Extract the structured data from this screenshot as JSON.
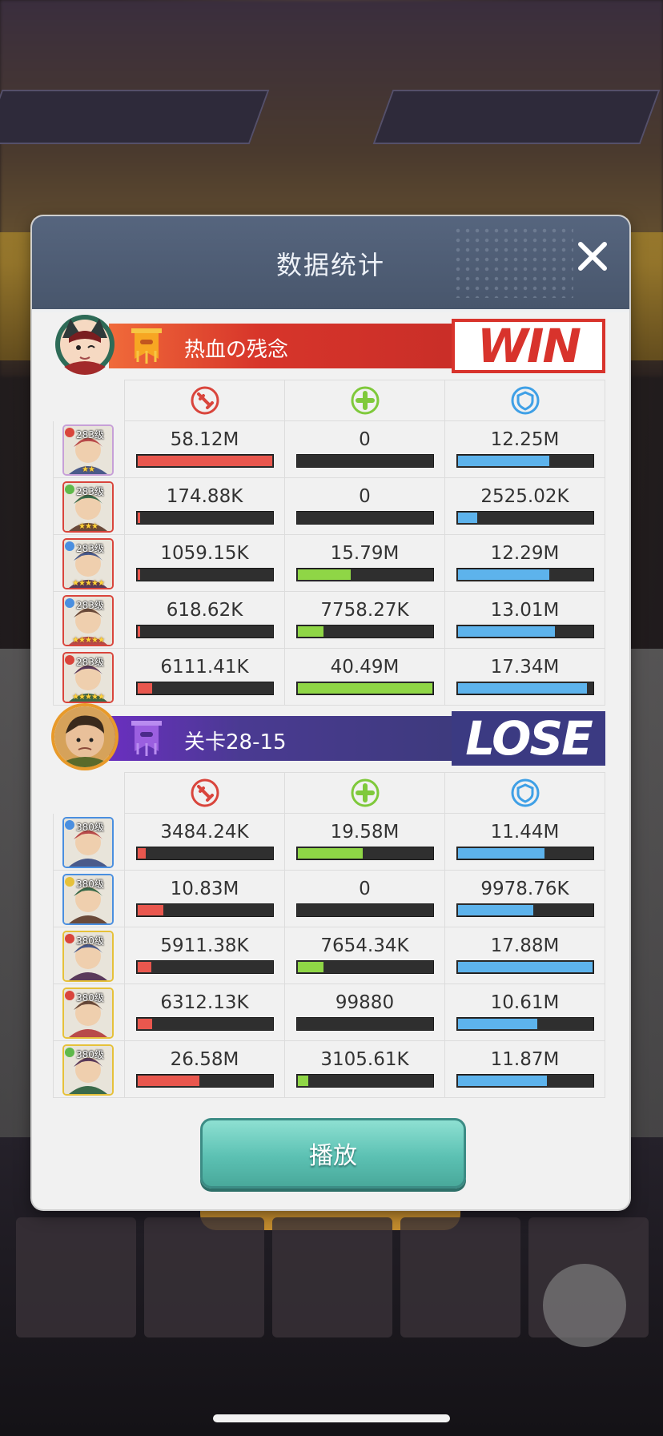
{
  "panel": {
    "title": "数据统计",
    "play_label": "播放"
  },
  "teams": [
    {
      "name": "热血の残念",
      "result": "WIN",
      "result_color": "#d8332c",
      "ribbon_color": "#d7352a",
      "heroes": [
        {
          "level": "283级",
          "element_color": "#d9453c",
          "stars": "★★",
          "border": "#c7a0d8",
          "damage": {
            "text": "58.12M",
            "fill": 1.0
          },
          "heal": {
            "text": "0",
            "fill": 0.0
          },
          "shield": {
            "text": "12.25M",
            "fill": 0.68
          }
        },
        {
          "level": "283级",
          "element_color": "#5fb94a",
          "stars": "★★★",
          "border": "#d9453c",
          "damage": {
            "text": "174.88K",
            "fill": 0.01
          },
          "heal": {
            "text": "0",
            "fill": 0.0
          },
          "shield": {
            "text": "2525.02K",
            "fill": 0.14
          }
        },
        {
          "level": "283级",
          "element_color": "#4a8fe0",
          "stars": "★★★★★",
          "border": "#d9453c",
          "damage": {
            "text": "1059.15K",
            "fill": 0.02
          },
          "heal": {
            "text": "15.79M",
            "fill": 0.39
          },
          "shield": {
            "text": "12.29M",
            "fill": 0.68
          }
        },
        {
          "level": "283级",
          "element_color": "#4a8fe0",
          "stars": "★★★★★",
          "border": "#d9453c",
          "damage": {
            "text": "618.62K",
            "fill": 0.01
          },
          "heal": {
            "text": "7758.27K",
            "fill": 0.19
          },
          "shield": {
            "text": "13.01M",
            "fill": 0.72
          }
        },
        {
          "level": "283级",
          "element_color": "#d9453c",
          "stars": "★★★★★",
          "border": "#d9453c",
          "damage": {
            "text": "6111.41K",
            "fill": 0.11
          },
          "heal": {
            "text": "40.49M",
            "fill": 1.0
          },
          "shield": {
            "text": "17.34M",
            "fill": 0.96
          }
        }
      ]
    },
    {
      "name": "关卡28-15",
      "result": "LOSE",
      "result_color": "#3b3a82",
      "ribbon_color": "#4a3a92",
      "heroes": [
        {
          "level": "380级",
          "element_color": "#4a8fe0",
          "stars": "",
          "border": "#4a8fe0",
          "damage": {
            "text": "3484.24K",
            "fill": 0.06
          },
          "heal": {
            "text": "19.58M",
            "fill": 0.48
          },
          "shield": {
            "text": "11.44M",
            "fill": 0.64
          }
        },
        {
          "level": "380级",
          "element_color": "#e6c13a",
          "stars": "",
          "border": "#4a8fe0",
          "damage": {
            "text": "10.83M",
            "fill": 0.19
          },
          "heal": {
            "text": "0",
            "fill": 0.0
          },
          "shield": {
            "text": "9978.76K",
            "fill": 0.56
          }
        },
        {
          "level": "380级",
          "element_color": "#d9453c",
          "stars": "",
          "border": "#e6c13a",
          "damage": {
            "text": "5911.38K",
            "fill": 0.1
          },
          "heal": {
            "text": "7654.34K",
            "fill": 0.19
          },
          "shield": {
            "text": "17.88M",
            "fill": 1.0
          }
        },
        {
          "level": "380级",
          "element_color": "#d9453c",
          "stars": "",
          "border": "#e6c13a",
          "damage": {
            "text": "6312.13K",
            "fill": 0.11
          },
          "heal": {
            "text": "99880",
            "fill": 0.0
          },
          "shield": {
            "text": "10.61M",
            "fill": 0.59
          }
        },
        {
          "level": "380级",
          "element_color": "#5fb94a",
          "stars": "",
          "border": "#e6c13a",
          "damage": {
            "text": "26.58M",
            "fill": 0.46
          },
          "heal": {
            "text": "3105.61K",
            "fill": 0.08
          },
          "shield": {
            "text": "11.87M",
            "fill": 0.66
          }
        }
      ]
    }
  ],
  "colors": {
    "damage": "#e9574e",
    "heal": "#8fd646",
    "shield": "#5db3ec"
  },
  "icons": {
    "damage": "sword-icon",
    "heal": "heal-cross-icon",
    "shield": "shield-icon",
    "close": "close-icon",
    "flag": "banner-flag-icon"
  }
}
